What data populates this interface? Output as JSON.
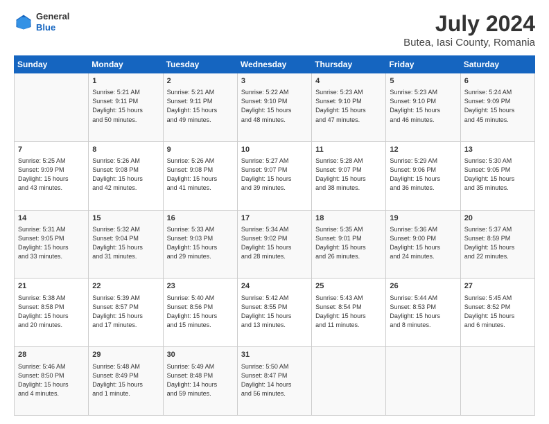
{
  "header": {
    "logo_line1": "General",
    "logo_line2": "Blue",
    "title": "July 2024",
    "subtitle": "Butea, Iasi County, Romania"
  },
  "days_of_week": [
    "Sunday",
    "Monday",
    "Tuesday",
    "Wednesday",
    "Thursday",
    "Friday",
    "Saturday"
  ],
  "weeks": [
    [
      {
        "day": "",
        "info": ""
      },
      {
        "day": "1",
        "info": "Sunrise: 5:21 AM\nSunset: 9:11 PM\nDaylight: 15 hours\nand 50 minutes."
      },
      {
        "day": "2",
        "info": "Sunrise: 5:21 AM\nSunset: 9:11 PM\nDaylight: 15 hours\nand 49 minutes."
      },
      {
        "day": "3",
        "info": "Sunrise: 5:22 AM\nSunset: 9:10 PM\nDaylight: 15 hours\nand 48 minutes."
      },
      {
        "day": "4",
        "info": "Sunrise: 5:23 AM\nSunset: 9:10 PM\nDaylight: 15 hours\nand 47 minutes."
      },
      {
        "day": "5",
        "info": "Sunrise: 5:23 AM\nSunset: 9:10 PM\nDaylight: 15 hours\nand 46 minutes."
      },
      {
        "day": "6",
        "info": "Sunrise: 5:24 AM\nSunset: 9:09 PM\nDaylight: 15 hours\nand 45 minutes."
      }
    ],
    [
      {
        "day": "7",
        "info": "Sunrise: 5:25 AM\nSunset: 9:09 PM\nDaylight: 15 hours\nand 43 minutes."
      },
      {
        "day": "8",
        "info": "Sunrise: 5:26 AM\nSunset: 9:08 PM\nDaylight: 15 hours\nand 42 minutes."
      },
      {
        "day": "9",
        "info": "Sunrise: 5:26 AM\nSunset: 9:08 PM\nDaylight: 15 hours\nand 41 minutes."
      },
      {
        "day": "10",
        "info": "Sunrise: 5:27 AM\nSunset: 9:07 PM\nDaylight: 15 hours\nand 39 minutes."
      },
      {
        "day": "11",
        "info": "Sunrise: 5:28 AM\nSunset: 9:07 PM\nDaylight: 15 hours\nand 38 minutes."
      },
      {
        "day": "12",
        "info": "Sunrise: 5:29 AM\nSunset: 9:06 PM\nDaylight: 15 hours\nand 36 minutes."
      },
      {
        "day": "13",
        "info": "Sunrise: 5:30 AM\nSunset: 9:05 PM\nDaylight: 15 hours\nand 35 minutes."
      }
    ],
    [
      {
        "day": "14",
        "info": "Sunrise: 5:31 AM\nSunset: 9:05 PM\nDaylight: 15 hours\nand 33 minutes."
      },
      {
        "day": "15",
        "info": "Sunrise: 5:32 AM\nSunset: 9:04 PM\nDaylight: 15 hours\nand 31 minutes."
      },
      {
        "day": "16",
        "info": "Sunrise: 5:33 AM\nSunset: 9:03 PM\nDaylight: 15 hours\nand 29 minutes."
      },
      {
        "day": "17",
        "info": "Sunrise: 5:34 AM\nSunset: 9:02 PM\nDaylight: 15 hours\nand 28 minutes."
      },
      {
        "day": "18",
        "info": "Sunrise: 5:35 AM\nSunset: 9:01 PM\nDaylight: 15 hours\nand 26 minutes."
      },
      {
        "day": "19",
        "info": "Sunrise: 5:36 AM\nSunset: 9:00 PM\nDaylight: 15 hours\nand 24 minutes."
      },
      {
        "day": "20",
        "info": "Sunrise: 5:37 AM\nSunset: 8:59 PM\nDaylight: 15 hours\nand 22 minutes."
      }
    ],
    [
      {
        "day": "21",
        "info": "Sunrise: 5:38 AM\nSunset: 8:58 PM\nDaylight: 15 hours\nand 20 minutes."
      },
      {
        "day": "22",
        "info": "Sunrise: 5:39 AM\nSunset: 8:57 PM\nDaylight: 15 hours\nand 17 minutes."
      },
      {
        "day": "23",
        "info": "Sunrise: 5:40 AM\nSunset: 8:56 PM\nDaylight: 15 hours\nand 15 minutes."
      },
      {
        "day": "24",
        "info": "Sunrise: 5:42 AM\nSunset: 8:55 PM\nDaylight: 15 hours\nand 13 minutes."
      },
      {
        "day": "25",
        "info": "Sunrise: 5:43 AM\nSunset: 8:54 PM\nDaylight: 15 hours\nand 11 minutes."
      },
      {
        "day": "26",
        "info": "Sunrise: 5:44 AM\nSunset: 8:53 PM\nDaylight: 15 hours\nand 8 minutes."
      },
      {
        "day": "27",
        "info": "Sunrise: 5:45 AM\nSunset: 8:52 PM\nDaylight: 15 hours\nand 6 minutes."
      }
    ],
    [
      {
        "day": "28",
        "info": "Sunrise: 5:46 AM\nSunset: 8:50 PM\nDaylight: 15 hours\nand 4 minutes."
      },
      {
        "day": "29",
        "info": "Sunrise: 5:48 AM\nSunset: 8:49 PM\nDaylight: 15 hours\nand 1 minute."
      },
      {
        "day": "30",
        "info": "Sunrise: 5:49 AM\nSunset: 8:48 PM\nDaylight: 14 hours\nand 59 minutes."
      },
      {
        "day": "31",
        "info": "Sunrise: 5:50 AM\nSunset: 8:47 PM\nDaylight: 14 hours\nand 56 minutes."
      },
      {
        "day": "",
        "info": ""
      },
      {
        "day": "",
        "info": ""
      },
      {
        "day": "",
        "info": ""
      }
    ]
  ]
}
